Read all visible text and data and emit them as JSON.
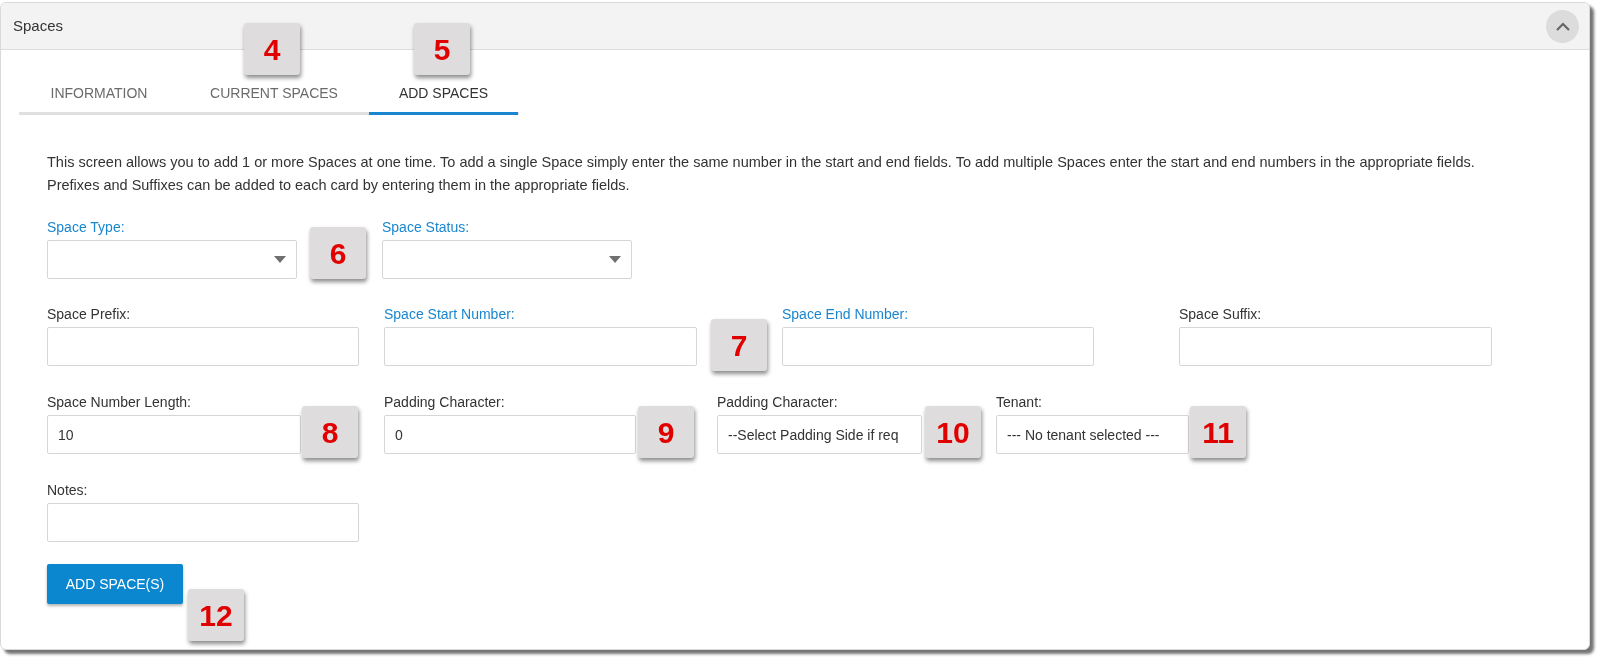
{
  "panel": {
    "title": "Spaces"
  },
  "tabs": [
    {
      "label": "INFORMATION",
      "selected": false
    },
    {
      "label": "CURRENT SPACES",
      "selected": false
    },
    {
      "label": "ADD SPACES",
      "selected": true
    }
  ],
  "description": "This screen allows you to add 1 or more Spaces at one time. To add a single Space simply enter the same number in the start and end fields. To add multiple Spaces enter the start and end numbers in the appropriate fields. Prefixes and Suffixes can be added to each card by entering them in the appropriate fields.",
  "form_rows": [
    [
      {
        "label": "Space Type:",
        "required": true,
        "kind": "select"
      },
      {
        "label": "Space Status:",
        "required": true,
        "kind": "select"
      }
    ],
    [
      {
        "label": "Space Prefix:",
        "required": false,
        "kind": "text"
      },
      {
        "label": "Space Start Number:",
        "required": true,
        "kind": "text"
      },
      {
        "label": "Space End Number:",
        "required": true,
        "kind": "text"
      },
      {
        "label": "Space Suffix:",
        "required": false,
        "kind": "text"
      }
    ],
    [
      {
        "label": "Space Number Length:",
        "required": false,
        "kind": "text",
        "value": "10"
      },
      {
        "label": "Padding Character:",
        "required": false,
        "kind": "text",
        "value": "0"
      },
      {
        "label": "Padding Character:",
        "required": false,
        "kind": "text",
        "value": "--Select Padding Side if req"
      },
      {
        "label": "Tenant:",
        "required": false,
        "kind": "text",
        "value": "--- No tenant selected ---"
      }
    ],
    [
      {
        "label": "Notes:",
        "required": false,
        "kind": "text"
      }
    ]
  ],
  "submit_button": "ADD SPACE(S)",
  "callouts": [
    "4",
    "5",
    "6",
    "7",
    "8",
    "9",
    "10",
    "11",
    "12"
  ]
}
